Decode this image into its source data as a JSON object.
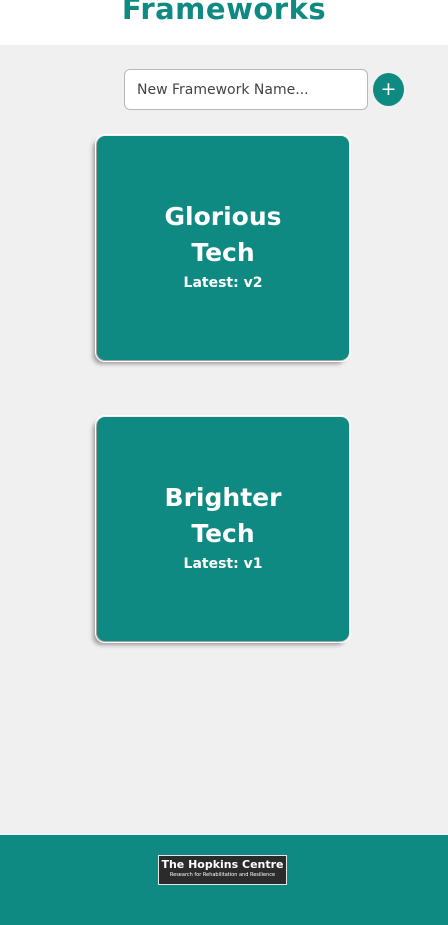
{
  "header": {
    "title": "Frameworks"
  },
  "new_framework": {
    "placeholder": "New Framework Name...",
    "value": "",
    "add_button_label": "+"
  },
  "frameworks": [
    {
      "name": "Glorious Tech",
      "latest": "Latest: v2"
    },
    {
      "name": "Brighter Tech",
      "latest": "Latest: v1"
    }
  ],
  "footer": {
    "logo_title": "The Hopkins Centre",
    "logo_subtitle": "Research for Rehabilitation and Resilience"
  },
  "colors": {
    "accent": "#0f8a82",
    "background": "#f0f0f0",
    "header_background": "#ffffff"
  }
}
